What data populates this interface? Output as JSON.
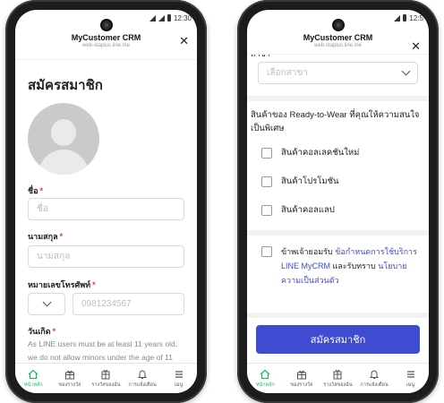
{
  "app": {
    "title": "MyCustomer CRM",
    "subtitle": "web-staplus.line.me"
  },
  "status": {
    "left_time": "12:30",
    "right_time": "12:5"
  },
  "left": {
    "page_title": "สมัครสมาชิก",
    "first_name": {
      "label": "ชื่อ",
      "placeholder": "ชื่อ"
    },
    "last_name": {
      "label": "นามสกุล",
      "placeholder": "นามสกุล"
    },
    "phone": {
      "label": "หมายเลขโทรศัพท์",
      "placeholder": "0981234567"
    },
    "birthday": {
      "label": "วันเกิด",
      "helper_1": "As LINE users must be at least 11 years old,",
      "helper_2": "we do not allow minors under the age of 11"
    }
  },
  "right": {
    "branch": {
      "label": "สาขา",
      "placeholder": "เลือกสาขา"
    },
    "interest_question": "สินค้าของ Ready-to-Wear ที่คุณให้ความสนใจเป็นพิเศษ",
    "options": [
      "สินค้าคอลเลคชันใหม่",
      "สินค้าโปรโมชัน",
      "สินค้าคอลแลป"
    ],
    "consent": {
      "prefix": "ข้าพเจ้ายอมรับ",
      "link1": "ข้อกำหนดการใช้บริการ LINE MyCRM",
      "middle": "และรับทราบ",
      "link2": "นโยบายความเป็นส่วนตัว"
    },
    "submit_label": "สมัครสมาชิก"
  },
  "nav": [
    {
      "label": "หน้าหลัก",
      "icon": "home-icon",
      "active": true
    },
    {
      "label": "ของรางวัล",
      "icon": "gift-icon",
      "active": false
    },
    {
      "label": "รางวัลของฉัน",
      "icon": "my-rewards-icon",
      "active": false
    },
    {
      "label": "การแจ้งเตือน",
      "icon": "bell-icon",
      "active": false
    },
    {
      "label": "เมนู",
      "icon": "menu-icon",
      "active": false
    }
  ],
  "colors": {
    "accent": "#3f4bd1",
    "active_nav": "#1db954",
    "required": "#e53935"
  }
}
